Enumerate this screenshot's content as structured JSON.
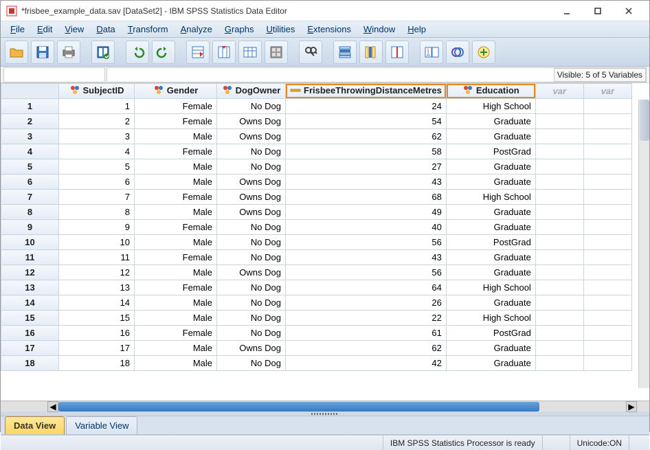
{
  "window": {
    "title": "*frisbee_example_data.sav [DataSet2] - IBM SPSS Statistics Data Editor"
  },
  "menu": {
    "items": [
      "File",
      "Edit",
      "View",
      "Data",
      "Transform",
      "Analyze",
      "Graphs",
      "Utilities",
      "Extensions",
      "Window",
      "Help"
    ]
  },
  "visible_info": "Visible: 5 of 5 Variables",
  "columns": [
    {
      "name": "SubjectID",
      "type": "nominal",
      "highlight": false
    },
    {
      "name": "Gender",
      "type": "nominal",
      "highlight": false
    },
    {
      "name": "DogOwner",
      "type": "nominal",
      "highlight": false
    },
    {
      "name": "FrisbeeThrowingDistanceMetres",
      "type": "scale",
      "highlight": true
    },
    {
      "name": "Education",
      "type": "nominal",
      "highlight": true
    }
  ],
  "empty_var_label": "var",
  "rows": [
    {
      "n": "1",
      "SubjectID": "1",
      "Gender": "Female",
      "DogOwner": "No Dog",
      "FrisbeeThrowingDistanceMetres": "24",
      "Education": "High School"
    },
    {
      "n": "2",
      "SubjectID": "2",
      "Gender": "Female",
      "DogOwner": "Owns Dog",
      "FrisbeeThrowingDistanceMetres": "54",
      "Education": "Graduate"
    },
    {
      "n": "3",
      "SubjectID": "3",
      "Gender": "Male",
      "DogOwner": "Owns Dog",
      "FrisbeeThrowingDistanceMetres": "62",
      "Education": "Graduate"
    },
    {
      "n": "4",
      "SubjectID": "4",
      "Gender": "Female",
      "DogOwner": "No Dog",
      "FrisbeeThrowingDistanceMetres": "58",
      "Education": "PostGrad"
    },
    {
      "n": "5",
      "SubjectID": "5",
      "Gender": "Male",
      "DogOwner": "No Dog",
      "FrisbeeThrowingDistanceMetres": "27",
      "Education": "Graduate"
    },
    {
      "n": "6",
      "SubjectID": "6",
      "Gender": "Male",
      "DogOwner": "Owns Dog",
      "FrisbeeThrowingDistanceMetres": "43",
      "Education": "Graduate"
    },
    {
      "n": "7",
      "SubjectID": "7",
      "Gender": "Female",
      "DogOwner": "Owns Dog",
      "FrisbeeThrowingDistanceMetres": "68",
      "Education": "High School"
    },
    {
      "n": "8",
      "SubjectID": "8",
      "Gender": "Male",
      "DogOwner": "Owns Dog",
      "FrisbeeThrowingDistanceMetres": "49",
      "Education": "Graduate"
    },
    {
      "n": "9",
      "SubjectID": "9",
      "Gender": "Female",
      "DogOwner": "No Dog",
      "FrisbeeThrowingDistanceMetres": "40",
      "Education": "Graduate"
    },
    {
      "n": "10",
      "SubjectID": "10",
      "Gender": "Male",
      "DogOwner": "No Dog",
      "FrisbeeThrowingDistanceMetres": "56",
      "Education": "PostGrad"
    },
    {
      "n": "11",
      "SubjectID": "11",
      "Gender": "Female",
      "DogOwner": "No Dog",
      "FrisbeeThrowingDistanceMetres": "43",
      "Education": "Graduate"
    },
    {
      "n": "12",
      "SubjectID": "12",
      "Gender": "Male",
      "DogOwner": "Owns Dog",
      "FrisbeeThrowingDistanceMetres": "56",
      "Education": "Graduate"
    },
    {
      "n": "13",
      "SubjectID": "13",
      "Gender": "Female",
      "DogOwner": "No Dog",
      "FrisbeeThrowingDistanceMetres": "64",
      "Education": "High School"
    },
    {
      "n": "14",
      "SubjectID": "14",
      "Gender": "Male",
      "DogOwner": "No Dog",
      "FrisbeeThrowingDistanceMetres": "26",
      "Education": "Graduate"
    },
    {
      "n": "15",
      "SubjectID": "15",
      "Gender": "Male",
      "DogOwner": "No Dog",
      "FrisbeeThrowingDistanceMetres": "22",
      "Education": "High School"
    },
    {
      "n": "16",
      "SubjectID": "16",
      "Gender": "Female",
      "DogOwner": "No Dog",
      "FrisbeeThrowingDistanceMetres": "61",
      "Education": "PostGrad"
    },
    {
      "n": "17",
      "SubjectID": "17",
      "Gender": "Male",
      "DogOwner": "Owns Dog",
      "FrisbeeThrowingDistanceMetres": "62",
      "Education": "Graduate"
    },
    {
      "n": "18",
      "SubjectID": "18",
      "Gender": "Male",
      "DogOwner": "No Dog",
      "FrisbeeThrowingDistanceMetres": "42",
      "Education": "Graduate"
    }
  ],
  "tabs": {
    "data_view": "Data View",
    "variable_view": "Variable View"
  },
  "status": {
    "processor": "IBM SPSS Statistics Processor is ready",
    "unicode": "Unicode:ON"
  }
}
